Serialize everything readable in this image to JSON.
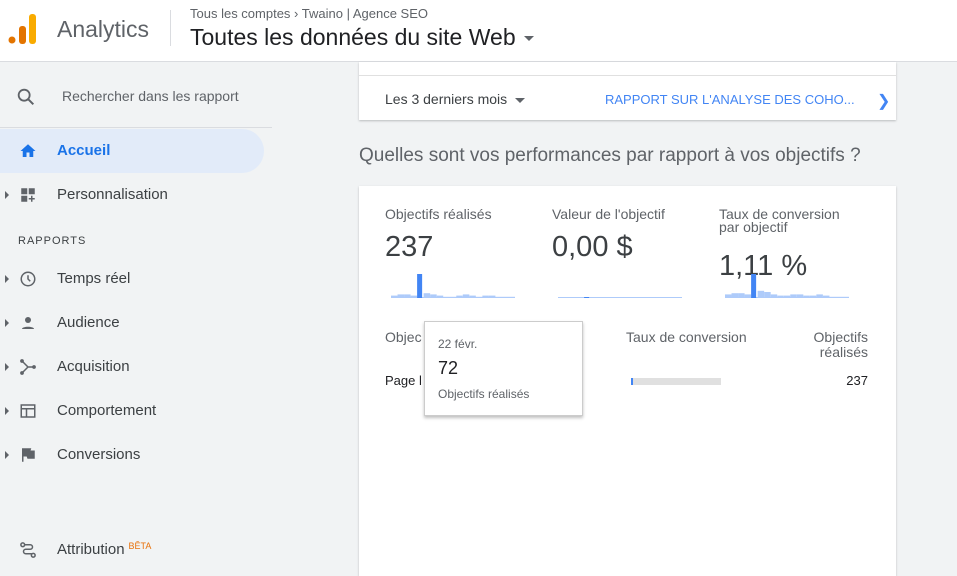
{
  "header": {
    "app_name": "Analytics",
    "breadcrumb": [
      "Tous les comptes",
      "Twaino | Agence SEO"
    ],
    "view_title": "Toutes les données du site Web"
  },
  "sidebar": {
    "search_placeholder": "Rechercher dans les rapport",
    "items": [
      {
        "label": "Accueil",
        "icon": "home-icon",
        "active": true
      },
      {
        "label": "Personnalisation",
        "icon": "dashboard-icon"
      }
    ],
    "section": "RAPPORTS",
    "reports": [
      {
        "label": "Temps réel",
        "icon": "clock-icon"
      },
      {
        "label": "Audience",
        "icon": "person-icon"
      },
      {
        "label": "Acquisition",
        "icon": "acquisition-icon"
      },
      {
        "label": "Comportement",
        "icon": "behavior-icon"
      },
      {
        "label": "Conversions",
        "icon": "flag-icon"
      }
    ],
    "attribution": {
      "label": "Attribution",
      "badge": "BÊTA"
    }
  },
  "cohort_card": {
    "period": "Les 3 derniers mois",
    "link": "RAPPORT SUR L'ANALYSE DES COHO..."
  },
  "question": "Quelles sont vos performances par rapport à vos objectifs ?",
  "metrics": [
    {
      "label": "Objectifs réalisés",
      "value": "237",
      "spark": [
        2,
        3,
        3,
        2,
        20,
        4,
        3,
        2,
        1,
        1,
        2,
        3,
        2,
        1,
        2,
        2,
        1,
        1,
        1
      ]
    },
    {
      "label": "Valeur de l'objectif",
      "value": "0,00 $",
      "spark": [
        0,
        0,
        0,
        0,
        0,
        0,
        0,
        0,
        0,
        0,
        0,
        0,
        0,
        0,
        0,
        0,
        0,
        0,
        0
      ]
    },
    {
      "label": "Taux de conversion par objectif",
      "value": "1,11 %",
      "spark": [
        3,
        4,
        4,
        3,
        20,
        6,
        5,
        3,
        2,
        2,
        3,
        3,
        2,
        2,
        3,
        2,
        1,
        1,
        1
      ]
    }
  ],
  "table": {
    "headers": [
      "Objec",
      "Taux de conversion",
      "Objectifs réalisés"
    ],
    "rows": [
      {
        "name": "Page l",
        "rate_fraction": 0.02,
        "completions": "237"
      }
    ]
  },
  "tooltip": {
    "date": "22 févr.",
    "value": "72",
    "label": "Objectifs réalisés"
  },
  "colors": {
    "accent": "#1a73e8",
    "spark_highlight": "#4285f4",
    "spark": "#aecbfa"
  }
}
